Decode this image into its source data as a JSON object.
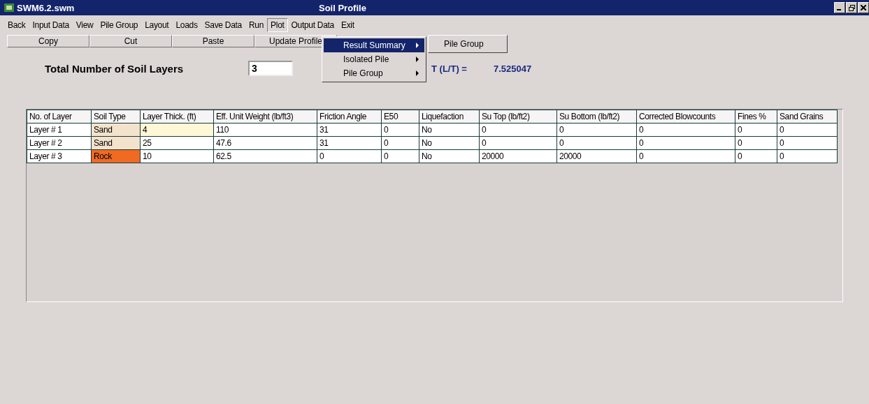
{
  "window": {
    "app_title": "SWM6.2.swm",
    "title": "Soil Profile"
  },
  "menu_bar": [
    {
      "label": "Back",
      "selected": false
    },
    {
      "label": "Input Data",
      "selected": false
    },
    {
      "label": "View",
      "selected": false
    },
    {
      "label": "Pile Group",
      "selected": false
    },
    {
      "label": "Layout",
      "selected": false
    },
    {
      "label": "Loads",
      "selected": false
    },
    {
      "label": "Save Data",
      "selected": false
    },
    {
      "label": "Run",
      "selected": false
    },
    {
      "label": "Plot",
      "selected": true
    },
    {
      "label": "Output Data",
      "selected": false
    },
    {
      "label": "Exit",
      "selected": false
    }
  ],
  "toolbar": [
    "Copy",
    "Cut",
    "Paste",
    "Update Profile"
  ],
  "plot_menu": [
    {
      "label": "Result Summary",
      "selected": true,
      "has_submenu": true
    },
    {
      "label": "Isolated Pile",
      "selected": false,
      "has_submenu": true
    },
    {
      "label": "Pile Group",
      "selected": false,
      "has_submenu": true
    }
  ],
  "submenu": [
    {
      "label": "Pile Group"
    }
  ],
  "layers_label": "Total Number of Soil Layers",
  "layers_value": "3",
  "ratio_label": "T (L/T) =",
  "ratio_value": "7.525047",
  "table": {
    "columns": [
      "No. of  Layer",
      "Soil Type",
      "Layer Thick. (ft)",
      "Eff. Unit Weight (lb/ft3)",
      "Friction Angle",
      "E50",
      "Liquefaction",
      "Su Top (lb/ft2)",
      "Su Bottom (lb/ft2)",
      "Corrected Blowcounts",
      "Fines %",
      "Sand Grains"
    ],
    "rows": [
      {
        "cells": [
          {
            "text": "Layer # 1",
            "selected": false
          },
          {
            "text": "Sand",
            "selected": false,
            "color": "#f3e3cc"
          },
          {
            "text": "4",
            "selected": true
          },
          {
            "text": "110",
            "selected": false
          },
          {
            "text": "31",
            "selected": false
          },
          {
            "text": "0",
            "selected": false
          },
          {
            "text": "No",
            "selected": false
          },
          {
            "text": "0",
            "selected": false
          },
          {
            "text": "0",
            "selected": false
          },
          {
            "text": "0",
            "selected": false
          },
          {
            "text": "0",
            "selected": false
          },
          {
            "text": "0",
            "selected": false
          }
        ]
      },
      {
        "cells": [
          {
            "text": "Layer # 2",
            "selected": false
          },
          {
            "text": "Sand",
            "selected": false,
            "color": "#f3e3cc"
          },
          {
            "text": "25",
            "selected": false
          },
          {
            "text": "47.6",
            "selected": false
          },
          {
            "text": "31",
            "selected": false
          },
          {
            "text": "0",
            "selected": false
          },
          {
            "text": "No",
            "selected": false
          },
          {
            "text": "0",
            "selected": false
          },
          {
            "text": "0",
            "selected": false
          },
          {
            "text": "0",
            "selected": false
          },
          {
            "text": "0",
            "selected": false
          },
          {
            "text": "0",
            "selected": false
          }
        ]
      },
      {
        "cells": [
          {
            "text": "Layer # 3",
            "selected": false
          },
          {
            "text": "Rock",
            "selected": false,
            "color": "#f06a22"
          },
          {
            "text": "10",
            "selected": false
          },
          {
            "text": "62.5",
            "selected": false
          },
          {
            "text": "0",
            "selected": false
          },
          {
            "text": "0",
            "selected": false
          },
          {
            "text": "No",
            "selected": false
          },
          {
            "text": "20000",
            "selected": false
          },
          {
            "text": "20000",
            "selected": false
          },
          {
            "text": "0",
            "selected": false
          },
          {
            "text": "0",
            "selected": false
          },
          {
            "text": "0",
            "selected": false
          }
        ]
      }
    ]
  }
}
